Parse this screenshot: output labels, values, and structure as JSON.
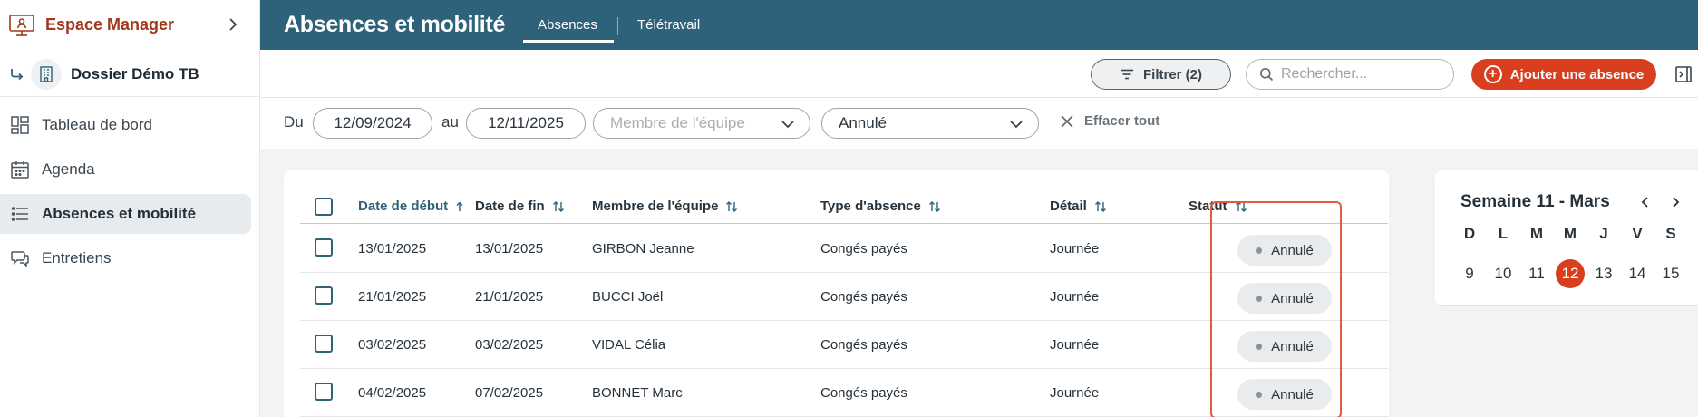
{
  "sidebar": {
    "brand": "Espace Manager",
    "folder_name": "Dossier Démo TB",
    "items": [
      {
        "label": "Tableau de bord",
        "icon": "dashboard-icon",
        "active": false
      },
      {
        "label": "Agenda",
        "icon": "calendar-icon",
        "active": false
      },
      {
        "label": "Absences et mobilité",
        "icon": "list-icon",
        "active": true
      },
      {
        "label": "Entretiens",
        "icon": "chat-icon",
        "active": false
      }
    ]
  },
  "header": {
    "title": "Absences et mobilité",
    "tabs": [
      {
        "label": "Absences",
        "active": true
      },
      {
        "label": "Télétravail",
        "active": false
      }
    ]
  },
  "toolbar": {
    "filter_label": "Filtrer (2)",
    "search_placeholder": "Rechercher...",
    "add_label": "Ajouter une absence"
  },
  "filters": {
    "from_label": "Du",
    "from_value": "12/09/2024",
    "to_label": "au",
    "to_value": "12/11/2025",
    "member_placeholder": "Membre de l'équipe",
    "status_value": "Annulé",
    "clear_label": "Effacer tout"
  },
  "table": {
    "columns": [
      "Date de début",
      "Date de fin",
      "Membre de l'équipe",
      "Type d'absence",
      "Détail",
      "Statut"
    ],
    "rows": [
      {
        "start": "13/01/2025",
        "end": "13/01/2025",
        "member": "GIRBON Jeanne",
        "type": "Congés payés",
        "detail": "Journée",
        "status": "Annulé"
      },
      {
        "start": "21/01/2025",
        "end": "21/01/2025",
        "member": "BUCCI Joël",
        "type": "Congés payés",
        "detail": "Journée",
        "status": "Annulé"
      },
      {
        "start": "03/02/2025",
        "end": "03/02/2025",
        "member": "VIDAL Célia",
        "type": "Congés payés",
        "detail": "Journée",
        "status": "Annulé"
      },
      {
        "start": "04/02/2025",
        "end": "07/02/2025",
        "member": "BONNET Marc",
        "type": "Congés payés",
        "detail": "Journée",
        "status": "Annulé"
      }
    ]
  },
  "calendar": {
    "title": "Semaine 11 - Mars",
    "weekdays": [
      "D",
      "L",
      "M",
      "M",
      "J",
      "V",
      "S"
    ],
    "days": [
      "9",
      "10",
      "11",
      "12",
      "13",
      "14",
      "15"
    ],
    "today": "12"
  },
  "colors": {
    "header_bg": "#2d627a",
    "accent": "#d93f1f",
    "brand": "#a2381e"
  }
}
